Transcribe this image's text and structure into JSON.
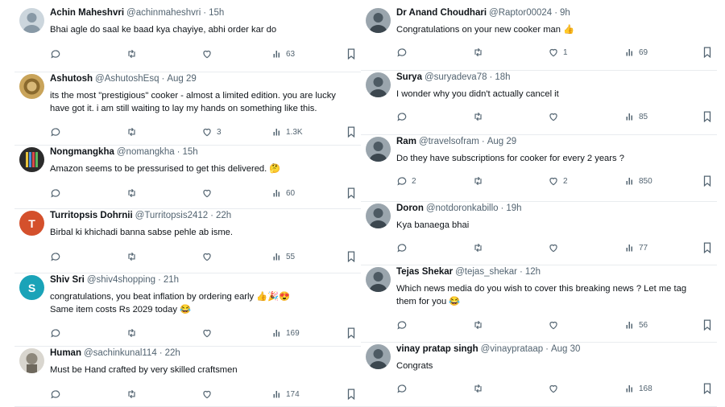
{
  "colors": {
    "text": "#0f1419",
    "muted": "#536471",
    "divider": "#e9ecef",
    "avatar_turritopsis": "#d4502c",
    "avatar_shiv": "#1aa3b8"
  },
  "left_column": [
    {
      "name": "Achin Maheshvri",
      "handle": "@achinmaheshvri",
      "sep": "·",
      "time": "15h",
      "lines": [
        "Bhai agle do saal ke baad kya chayiye, abhi order kar do"
      ],
      "stats": {
        "replies": "",
        "reposts": "",
        "likes": "",
        "views": "63"
      },
      "avatar": {
        "icon": "default-user-icon"
      }
    },
    {
      "name": "Ashutosh",
      "handle": "@AshutoshEsq",
      "sep": "·",
      "time": "Aug 29",
      "lines": [
        "its the most \"prestigious\" cooker - almost a limited edition. you are lucky",
        "have got it. i am still waiting to lay my hands on something like this."
      ],
      "stats": {
        "replies": "",
        "reposts": "",
        "likes": "3",
        "views": "1.3K"
      },
      "avatar": {
        "icon": "emblem-avatar-icon"
      }
    },
    {
      "name": "Nongmangkha",
      "handle": "@nomangkha",
      "sep": "·",
      "time": "15h",
      "lines": [
        "Amazon seems to be pressurised to get this delivered. 🤔"
      ],
      "stats": {
        "replies": "",
        "reposts": "",
        "likes": "",
        "views": "60"
      },
      "avatar": {
        "icon": "stripes-avatar-icon"
      }
    },
    {
      "name": "Turritopsis Dohrnii",
      "handle": "@Turritopsis2412",
      "sep": "·",
      "time": "22h",
      "lines": [
        "Birbal ki khichadi banna sabse pehle ab isme."
      ],
      "stats": {
        "replies": "",
        "reposts": "",
        "likes": "",
        "views": "55"
      },
      "avatar": {
        "initial": "T"
      }
    },
    {
      "name": "Shiv Sri",
      "handle": "@shiv4shopping",
      "sep": "·",
      "time": "21h",
      "lines": [
        "congratulations, you beat inflation by ordering early 👍🎉😍",
        "Same item costs Rs 2029 today 😂"
      ],
      "stats": {
        "replies": "",
        "reposts": "",
        "likes": "",
        "views": "169"
      },
      "avatar": {
        "initial": "S"
      }
    },
    {
      "name": "Human",
      "handle": "@sachinkunal114",
      "sep": "·",
      "time": "22h",
      "lines": [
        "Must be Hand crafted by very skilled craftsmen"
      ],
      "stats": {
        "replies": "",
        "reposts": "",
        "likes": "",
        "views": "174"
      },
      "avatar": {
        "icon": "statue-avatar-icon"
      }
    }
  ],
  "right_column": [
    {
      "name": "Dr Anand Choudhari",
      "handle": "@Raptor00024",
      "sep": "·",
      "time": "9h",
      "lines": [
        "Congratulations on your new cooker man 👍"
      ],
      "stats": {
        "replies": "",
        "reposts": "",
        "likes": "1",
        "views": "69"
      },
      "avatar": {
        "icon": "photo-avatar-icon"
      }
    },
    {
      "name": "Surya",
      "handle": "@suryadeva78",
      "sep": "·",
      "time": "18h",
      "lines": [
        "I wonder why you didn't actually cancel it"
      ],
      "stats": {
        "replies": "",
        "reposts": "",
        "likes": "",
        "views": "85"
      },
      "avatar": {
        "icon": "photo-avatar-icon"
      }
    },
    {
      "name": "Ram",
      "handle": "@travelsofram",
      "sep": "·",
      "time": "Aug 29",
      "lines": [
        "Do they have subscriptions for cooker for every 2 years ?"
      ],
      "stats": {
        "replies": "2",
        "reposts": "",
        "likes": "2",
        "views": "850"
      },
      "avatar": {
        "icon": "photo-avatar-icon"
      }
    },
    {
      "name": "Doron",
      "handle": "@notdoronkabillo",
      "sep": "·",
      "time": "19h",
      "lines": [
        "Kya banaega bhai"
      ],
      "stats": {
        "replies": "",
        "reposts": "",
        "likes": "",
        "views": "77"
      },
      "avatar": {
        "icon": "photo-avatar-icon"
      }
    },
    {
      "name": "Tejas Shekar",
      "handle": "@tejas_shekar",
      "sep": "·",
      "time": "12h",
      "lines": [
        "Which news media do you wish to cover this breaking news ? Let me tag",
        "them for you 😂"
      ],
      "stats": {
        "replies": "",
        "reposts": "",
        "likes": "",
        "views": "56"
      },
      "avatar": {
        "icon": "photo-avatar-icon"
      }
    },
    {
      "name": "vinay pratap singh",
      "handle": "@vinayprataap",
      "sep": "·",
      "time": "Aug 30",
      "lines": [
        "Congrats"
      ],
      "stats": {
        "replies": "",
        "reposts": "",
        "likes": "",
        "views": "168"
      },
      "avatar": {
        "icon": "photo-avatar-icon"
      }
    }
  ]
}
